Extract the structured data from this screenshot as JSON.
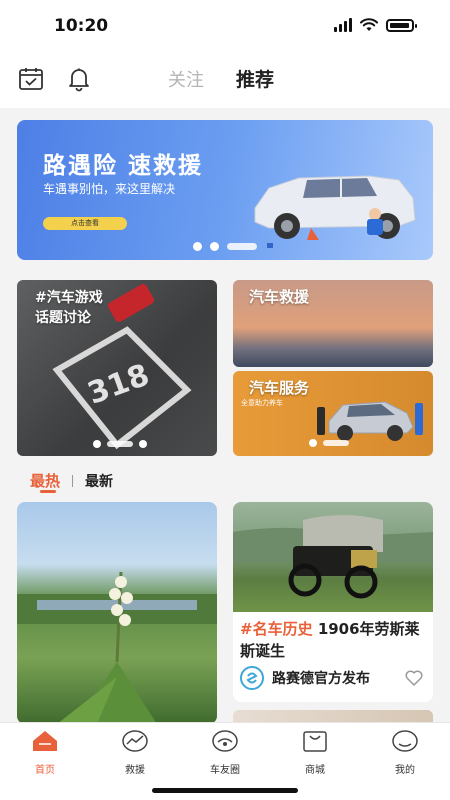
{
  "status": {
    "time": "10:20"
  },
  "header": {
    "tabs": [
      "关注",
      "推荐"
    ],
    "active_tab": "推荐",
    "left_icons": [
      "calendar-check-icon",
      "bell-icon"
    ]
  },
  "banner": {
    "title": "路遇险  速救援",
    "subtitle": "车遇事别怕，来这里解决",
    "button_label": "点击查看",
    "slide_count": 3,
    "active_slide": 2
  },
  "tiles": {
    "game": {
      "label": "#汽车游戏\n话题讨论"
    },
    "rescue": {
      "label": "汽车救援"
    },
    "service": {
      "label": "汽车服务",
      "caption": "全意助力养车"
    }
  },
  "sort": {
    "hot": "最热",
    "new": "最新",
    "active": "最热"
  },
  "feed": {
    "car_card": {
      "tag": "#名车历史",
      "title": "1906年劳斯莱斯诞生",
      "author": "路赛德官方发布"
    }
  },
  "tabbar": {
    "items": [
      {
        "label": "首页",
        "icon": "home-icon",
        "active": true
      },
      {
        "label": "救援",
        "icon": "rescue-icon",
        "active": false
      },
      {
        "label": "车友圈",
        "icon": "car-circle-icon",
        "active": false
      },
      {
        "label": "商城",
        "icon": "shop-icon",
        "active": false
      },
      {
        "label": "我的",
        "icon": "profile-icon",
        "active": false
      }
    ]
  },
  "colors": {
    "accent": "#e8613a",
    "banner_blue": "#5b8ff0",
    "service_orange": "#e89b38"
  }
}
